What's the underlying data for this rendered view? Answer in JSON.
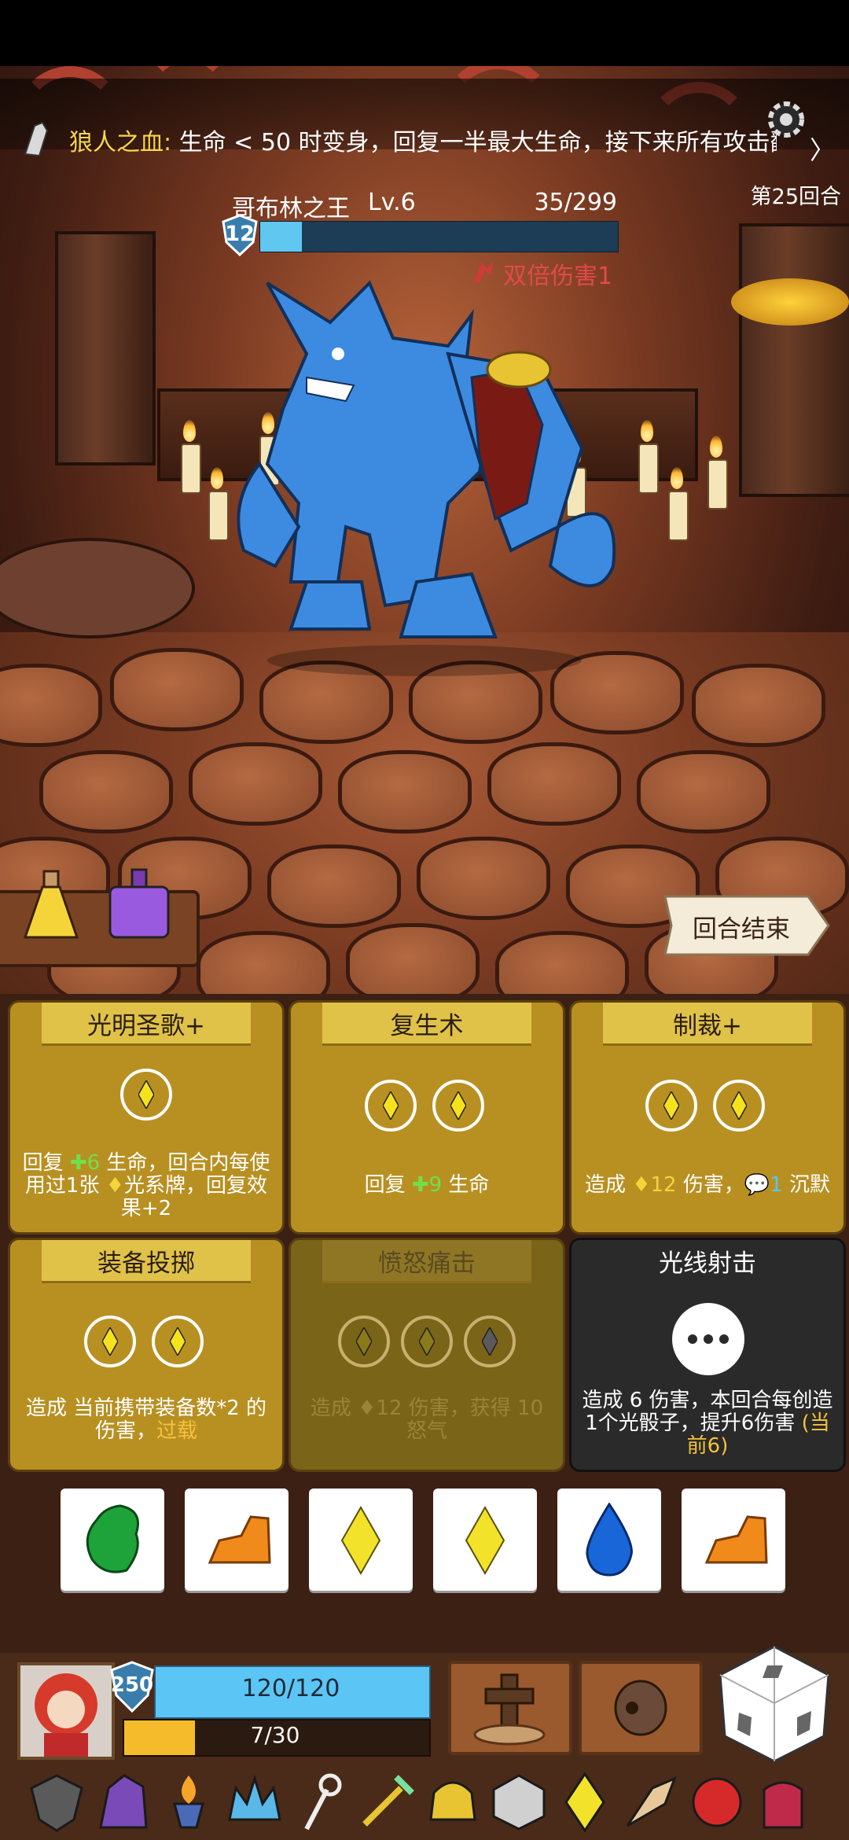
{
  "status_bar": {},
  "banner": {
    "title": "狼人之血:",
    "text": " 生命 < 50 时变身，回复一半最大生命，接下来所有攻击翻倍",
    "chevron": "〉"
  },
  "round": "第25回合",
  "enemy": {
    "name": "哥布林之王",
    "level": "Lv.6",
    "hp_text": "35/299",
    "hp_fraction": 0.117,
    "shield": "12",
    "buff": "双倍伤害1"
  },
  "end_turn_label": "回合结束",
  "cards": [
    {
      "title": "光明圣歌+",
      "dice": [
        "diamond"
      ],
      "desc_parts": [
        "回复 ",
        "✚6",
        " 生命，回合内每使用过1张 ",
        "♦",
        "光系牌，回复效果+2"
      ]
    },
    {
      "title": "复生术",
      "dice": [
        "diamond",
        "diamond"
      ],
      "desc_parts": [
        "回复 ",
        "✚9",
        " 生命"
      ]
    },
    {
      "title": "制裁+",
      "dice": [
        "diamond",
        "diamond"
      ],
      "desc_parts": [
        "造成 ",
        "♦12",
        " 伤害，",
        "💬1",
        " 沉默"
      ]
    },
    {
      "title": "装备投掷",
      "dice": [
        "diamond",
        "diamond"
      ],
      "desc_parts": [
        "造成 当前携带装备数*2 的伤害，",
        "过载"
      ]
    },
    {
      "title": "愤怒痛击",
      "dice": [
        "diamond",
        "diamond",
        "diamond"
      ],
      "desc_parts": [
        "造成 ",
        "♦12",
        " 伤害，获得 ",
        "10",
        " 怒气"
      ]
    },
    {
      "title": "光线射击",
      "dice": [
        "more"
      ],
      "desc_parts": [
        "造成 ",
        "6",
        " 伤害，本回合每创造1个光骰子，提升6伤害 ",
        "(当前6)"
      ]
    }
  ],
  "dice_pool": [
    {
      "name": "leaf",
      "color": "#1ea23a"
    },
    {
      "name": "rock",
      "color": "#f08a1a"
    },
    {
      "name": "diamond",
      "color": "#f2e22a"
    },
    {
      "name": "diamond",
      "color": "#f2e22a"
    },
    {
      "name": "drop",
      "color": "#1866d8"
    },
    {
      "name": "rock",
      "color": "#f08a1a"
    }
  ],
  "player": {
    "shield": "250",
    "hp_text": "120/120",
    "hp_fraction": 1.0,
    "rage_text": "7/30",
    "rage_fraction": 0.233
  },
  "relics": [
    "shield-relic",
    "hood-relic",
    "brazier-relic",
    "crown-relic",
    "staff-relic",
    "sword-relic",
    "helmet-relic",
    "d20-relic",
    "gem-relic",
    "horn-relic",
    "ruby-relic",
    "glove-relic"
  ],
  "colors": {
    "gold_card": "#b89022",
    "dark_card": "#2a2a2a",
    "hp_bar": "#5bc6f5",
    "rage_bar": "#f5bb2a",
    "buff_red": "#e24a4a"
  }
}
